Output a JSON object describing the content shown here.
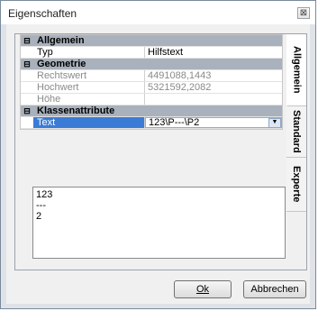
{
  "window": {
    "title": "Eigenschaften",
    "close_glyph": "⊠"
  },
  "tabs": [
    "Allgemein",
    "Standard",
    "Experte"
  ],
  "grid": {
    "categories": [
      {
        "label": "Allgemein",
        "toggle": "⊟"
      },
      {
        "label": "Geometrie",
        "toggle": "⊟"
      },
      {
        "label": "Klassenattribute",
        "toggle": "⊟"
      }
    ],
    "rows": {
      "typ": {
        "name": "Typ",
        "value": "Hilfstext"
      },
      "rechtswert": {
        "name": "Rechtswert",
        "value": "4491088,1443"
      },
      "hochwert": {
        "name": "Hochwert",
        "value": "5321592,2082"
      },
      "hoehe": {
        "name": "Höhe",
        "value": ""
      },
      "text": {
        "name": "Text",
        "value": "123\\P---\\P2"
      }
    }
  },
  "dropdown": {
    "lines": [
      "123",
      "---",
      "2"
    ]
  },
  "buttons": {
    "ok": "Ok",
    "abbrechen": "Abbrechen"
  }
}
